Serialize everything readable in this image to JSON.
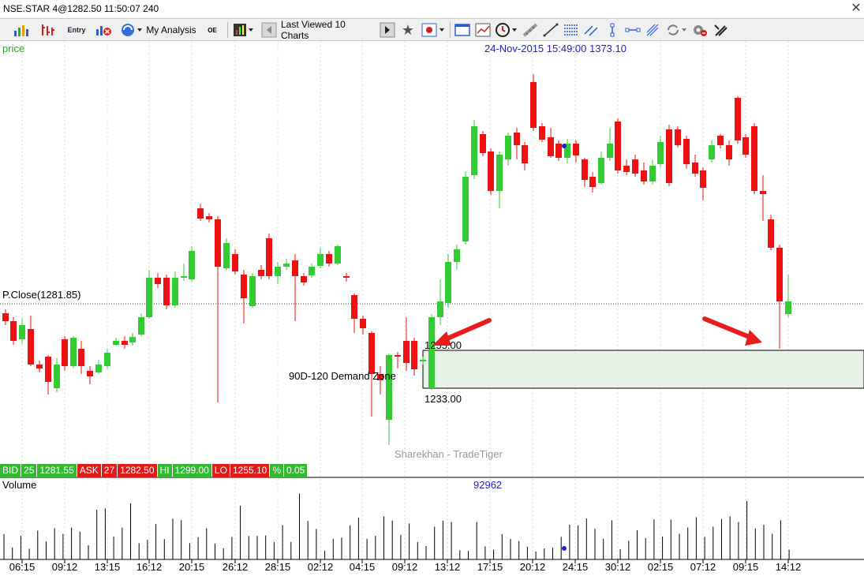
{
  "window": {
    "title": "NSE.STAR 4@1282.50 11:50:07 240"
  },
  "toolbar": {
    "my_analysis": "My Analysis",
    "last_viewed": "Last Viewed 10 Charts",
    "icons": [
      "chart-bars-icon",
      "chart-hlc-icon",
      "entry-icon",
      "delete-chart-icon",
      "analysis-globe-icon",
      "oe-icon",
      "color-bars-icon",
      "back-arrow-icon",
      "forward-arrow-icon",
      "star-icon",
      "template-icon",
      "new-window-icon",
      "trendline-chart-icon",
      "alarm-icon",
      "ruler-icon",
      "draw-line-icon",
      "fib-icon",
      "vertical-line-icon",
      "horizontal-line-icon",
      "pitchfork-icon",
      "cycle-icon",
      "settings-icon",
      "tools-icon"
    ]
  },
  "chart": {
    "price_label": "price",
    "crosshair_info": "24-Nov-2015  15:49:00  1373.10",
    "prev_close_label": "P.Close(1281.85)",
    "demand_zone_label": "90D-120 Demand Zone",
    "zone_top_label": "1255.00",
    "zone_bottom_label": "1233.00",
    "watermark": "Sharekhan - TradeTiger",
    "volume_label": "Volume",
    "volume_value": "92962",
    "time_labels": [
      "06:15",
      "09:12",
      "13:15",
      "16:12",
      "20:15",
      "26:12",
      "28:15",
      "02:12",
      "04:15",
      "09:12",
      "13:12",
      "17:15",
      "20:12",
      "24:15",
      "30:12",
      "02:15",
      "07:12",
      "09:15",
      "14:12"
    ],
    "colors": {
      "up": "#33cc33",
      "down": "#ee1111",
      "zone": "#e6f2e6",
      "arrow": "#e81e1e",
      "info": "#2222cc"
    }
  },
  "quote": {
    "bid_label": "BID",
    "bid_qty": "25",
    "bid_price": "1281.55",
    "ask_label": "ASK",
    "ask_qty": "27",
    "ask_price": "1282.50",
    "hi_label": "HI",
    "hi_value": "1299.00",
    "lo_label": "LO",
    "lo_value": "1255.10",
    "pct_label": "%",
    "pct_value": "0.05"
  }
}
